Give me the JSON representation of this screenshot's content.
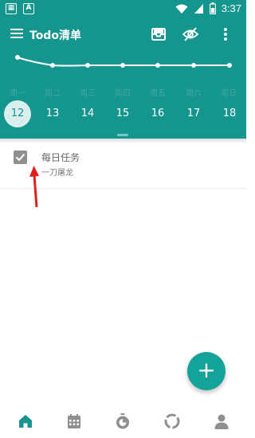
{
  "status_bar": {
    "left_icons": [
      "sim-icon",
      "a-icon"
    ],
    "right_icons": [
      "wifi-icon",
      "signal-icon",
      "battery-icon"
    ],
    "time": "3:37"
  },
  "app_bar": {
    "title": "Todo清单",
    "actions": [
      "inbox-icon",
      "eye-off-icon",
      "more-vert-icon"
    ]
  },
  "week": {
    "weekdays": [
      "周一",
      "周二",
      "周三",
      "周四",
      "周五",
      "周六",
      "周日"
    ],
    "dates": [
      "12",
      "13",
      "14",
      "15",
      "16",
      "17",
      "18"
    ],
    "selected_date": "12"
  },
  "tasks": [
    {
      "title": "每日任务",
      "subtitle": "一刀屠龙",
      "checked": true
    }
  ],
  "fab": {
    "label": "+"
  },
  "bottom_nav": {
    "items": [
      "home-icon",
      "calendar-icon",
      "timer-icon",
      "stats-icon",
      "profile-icon"
    ],
    "active": "home-icon"
  },
  "colors": {
    "primary": "#14958d",
    "accent": "#14a39a",
    "annotation": "#e0201b"
  }
}
